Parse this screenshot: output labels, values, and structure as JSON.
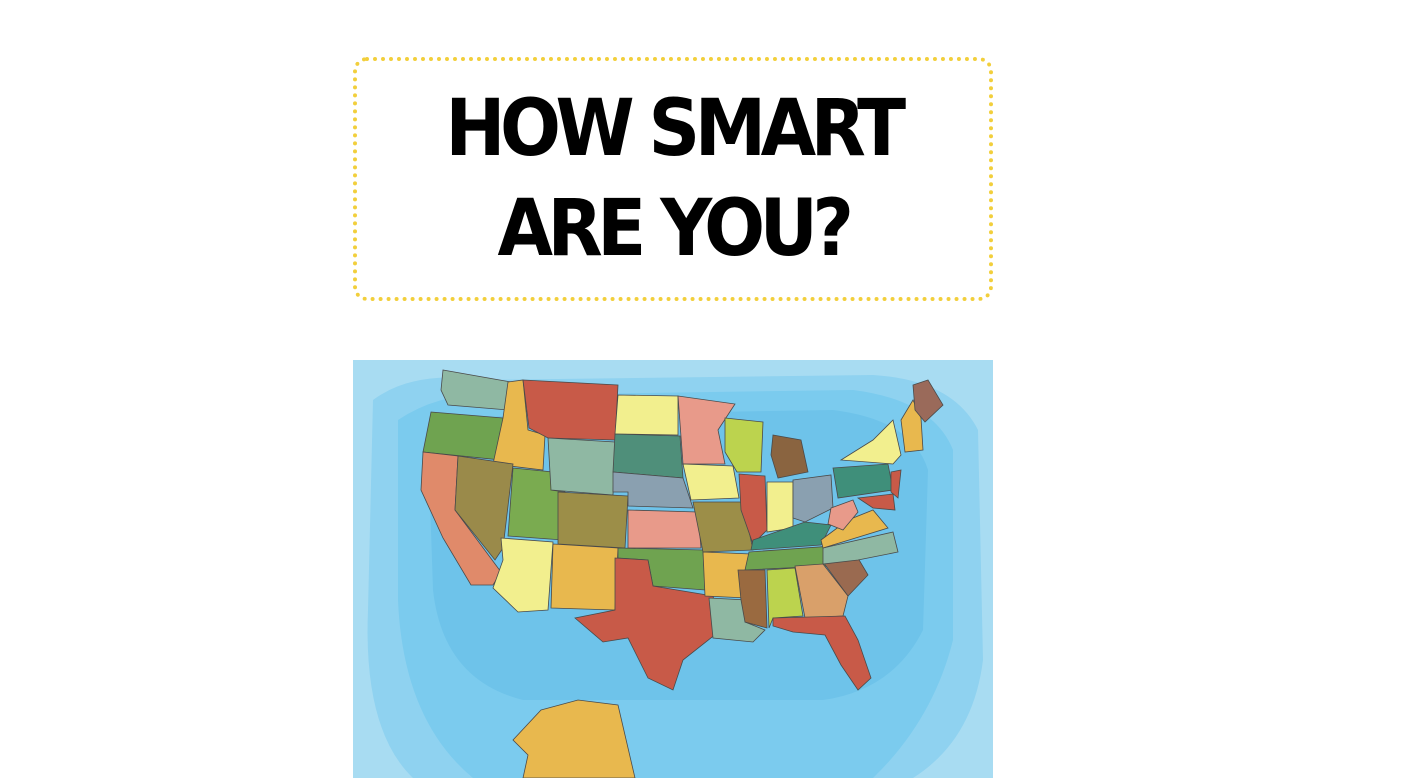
{
  "post": {
    "title": "HOW SMART ARE YOU?"
  },
  "map_image": {
    "subject": "map of the United States with states in different colors",
    "colors": {
      "ocean_light": "#a8dcf2",
      "ocean_mid": "#86cdee",
      "ocean_deep": "#6ec3ea",
      "border_accent": "#f2cf3c"
    }
  }
}
